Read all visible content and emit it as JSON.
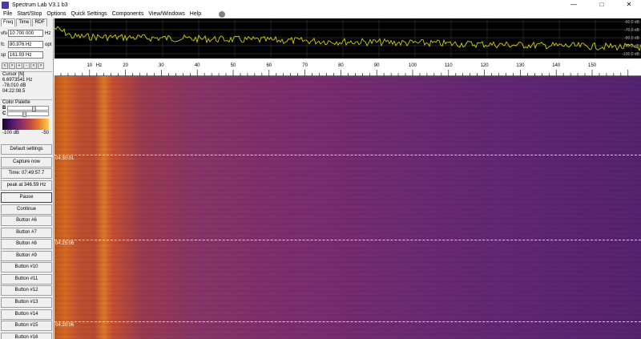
{
  "window": {
    "title": "Spectrum Lab V3.1 b3",
    "minimize": "—",
    "maximize": "□",
    "close": "✕"
  },
  "menu": [
    "File",
    "Start/Stop",
    "Options",
    "Quick Settings",
    "Components",
    "View/Windows",
    "Help"
  ],
  "tabs": [
    "Freq",
    "Time",
    "RDF"
  ],
  "fields": {
    "vfo": {
      "label": "vfo",
      "value": "10 700 000",
      "unit": "Hz"
    },
    "fc": {
      "label": "fc",
      "value": "80.976 Hz",
      "unit": "opt"
    },
    "sp": {
      "label": "sp",
      "value": "161.93 Hz",
      "unit": ""
    }
  },
  "arrow_buttons": [
    "<",
    ">",
    "+",
    "-",
    "<",
    ">"
  ],
  "cursor": {
    "title": "Cursor [N]",
    "freq": "6.6973541 Hz",
    "level": "-78.010 dB",
    "time": "04:22:08.5"
  },
  "palette": {
    "title": "Color Palette",
    "b_label": "B",
    "c_label": "C",
    "min": "-100 dB",
    "max": "-50"
  },
  "buttons": {
    "default_settings": "Default settings",
    "capture_now": "Capture now",
    "time": "Time:  07:49:57.7",
    "peak": "peak at 346.59 Hz",
    "pause": "Pause",
    "continue": "Continue",
    "b6": "Button #6",
    "b7": "Button #7",
    "b8": "Button #8",
    "b9": "Button #9",
    "b10": "Button #10",
    "b11": "Button #11",
    "b12": "Button #12",
    "b13": "Button #13",
    "b14": "Button #14",
    "b15": "Button #15",
    "b16": "Button #16"
  },
  "spectrum": {
    "db_labels": [
      "-60.0 dB",
      "-70.0 dB",
      "-80.0 dB",
      "-90.0 dB",
      "-100.0 dB"
    ],
    "trace_color": "#e6e600",
    "grid_color": "#505050"
  },
  "freq_axis": {
    "unit": "Hz",
    "ticks": [
      "10",
      "20",
      "30",
      "40",
      "50",
      "60",
      "70",
      "80",
      "90",
      "100",
      "110",
      "120",
      "130",
      "140",
      "150"
    ]
  },
  "waterfall": {
    "timestamps": [
      "04:30:01",
      "04:25:06",
      "04:20:06"
    ]
  }
}
